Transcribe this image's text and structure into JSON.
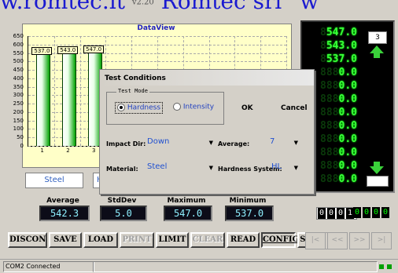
{
  "banner": {
    "left": "w.romtec.it",
    "middle": "v2.20",
    "right": "Romtec srl",
    "edge": "w"
  },
  "chart_data": {
    "type": "bar",
    "title": "DataView",
    "categories": [
      "1",
      "2",
      "3"
    ],
    "values": [
      537.0,
      543.0,
      547.0
    ],
    "data_labels": [
      "537.0",
      "543.0",
      "547.0"
    ],
    "y_ticks": [
      "650",
      "600",
      "550",
      "500",
      "450",
      "400",
      "350",
      "300",
      "250",
      "200",
      "150",
      "100",
      "50",
      "0"
    ],
    "ylim": [
      0,
      650
    ],
    "grid": true,
    "bar_color": "#00a000"
  },
  "tabs": {
    "material": "Steel",
    "second": "H"
  },
  "stats": {
    "average": {
      "label": "Average",
      "value": "542.3"
    },
    "stddev": {
      "label": "StdDev",
      "value": "5.0"
    },
    "maximum": {
      "label": "Maximum",
      "value": "547.0"
    },
    "minimum": {
      "label": "Minimum",
      "value": "537.0"
    }
  },
  "led_list": {
    "rows": [
      "547.0",
      "543.0",
      "537.0",
      "0.0",
      "0.0",
      "0.0",
      "0.0",
      "0.0",
      "0.0",
      "0.0",
      "0.0",
      "0.0"
    ],
    "right_box_value": "3",
    "up_arrow_icon": "arrow-up-icon",
    "down_arrow_icon": "arrow-down-icon"
  },
  "counters": {
    "white": [
      "0",
      "0",
      "0",
      "1"
    ],
    "green": [
      "0",
      "0",
      "0",
      "0"
    ]
  },
  "toolbar": {
    "buttons": [
      "DISCON",
      "SAVE",
      "LOAD",
      "PRINT",
      "LIMIT",
      "CLEAR",
      "READ",
      "CONFIG",
      "START"
    ],
    "nav": [
      "|<",
      "<<",
      ">>",
      ">|"
    ]
  },
  "status": {
    "text": "COM2 Connected"
  },
  "dialog": {
    "title": "Test Conditions",
    "test_mode_legend": "Test Mode",
    "mode_hardness": "Hardness",
    "mode_intensity": "Intensity",
    "ok": "OK",
    "cancel": "Cancel",
    "impact_dir_label": "Impact Dir:",
    "impact_dir_value": "Down",
    "average_label": "Average:",
    "average_value": "7",
    "material_label": "Material:",
    "material_value": "Steel",
    "hardness_system_label": "Hardness System:",
    "hardness_system_value": "HL"
  },
  "colors": {
    "accent_blue": "#2050d0",
    "led_green": "#3aff3a",
    "chart_bg": "#ffffc8"
  }
}
